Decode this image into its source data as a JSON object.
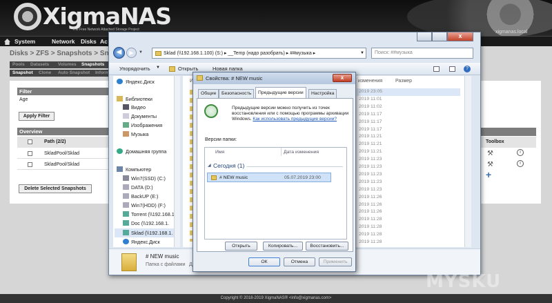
{
  "app": {
    "brand": "XigmaNAS",
    "tagline": "The Free Network Attached Storage Project",
    "hostname": "xigmanas.local"
  },
  "menu": [
    "System",
    "Network",
    "Disks",
    "Ac"
  ],
  "breadcrumb": "Disks > ZFS > Snapshots > Snap",
  "tabs1": [
    "Pools",
    "Datasets",
    "Volumes",
    "Snapshots"
  ],
  "tabs2": [
    "Snapshot",
    "Clone",
    "Auto Snapshot",
    "Inform"
  ],
  "filter": {
    "header": "Filter",
    "label": "Age",
    "button": "Apply Filter"
  },
  "overview": {
    "header": "Overview",
    "path_header": "Path (2/2)",
    "toolbox_header": "Toolbox",
    "rows": [
      "SkladPool/Sklad",
      "SkladPool/Sklad"
    ],
    "delete_button": "Delete Selected Snapshots"
  },
  "explorer": {
    "address": "Sklad (\\\\192.168.1.100) (S:)  ▸  __Temp (надо разобрать)  ▸  ##музыка  ▸",
    "search_placeholder": "Поиск: ##музыка",
    "toolbar": {
      "organize": "Упорядочить",
      "open": "Открыть",
      "new_folder": "Новая папка"
    },
    "columns": {
      "name": "И",
      "modified": "изменения",
      "size": "Размер"
    },
    "nav_items": [
      "Яндекс.Диск",
      "Библиотеки",
      "Видео",
      "Документы",
      "Изображения",
      "Музыка",
      "Домашняя группа",
      "Компьютер",
      "Win7(SSD) (C:)",
      "DATA (D:)",
      "BackUP (E:)",
      "Win7(HDD) (F:)",
      "Torrent (\\\\192.168.1",
      "Doc (\\\\192.168.1.",
      "Sklad (\\\\192.168.1.",
      "Яндекс.Диск"
    ],
    "dates": [
      "2019 23:05",
      "2019 11:01",
      "2019 11:02",
      "2019 11:17",
      "2019 11:17",
      "2019 11:17",
      "2019 11:21",
      "2019 11:21",
      "2019 11:21",
      "2019 11:23",
      "2019 11:23",
      "2019 11:23",
      "2019 11:23",
      "2019 11:23",
      "2019 11:26",
      "2019 11:26",
      "2019 11:26",
      "2019 11:28",
      "2019 11:28",
      "2019 11:28",
      "2019 11:28"
    ],
    "details": {
      "name": "# NEW music",
      "type": "Папка с файлами",
      "type_prefix": "Д"
    }
  },
  "dialog": {
    "title": "Свойства: # NEW music",
    "close": "x",
    "tabs": [
      "Общие",
      "Безопасность",
      "Предыдущие версии",
      "Настройка"
    ],
    "info_plain": "Предыдущие версии можно получить из точек восстановления или с помощью программы архивации Windows. ",
    "info_link": "Как использовать предыдущие версии?",
    "versions_label": "Версии папки:",
    "col_name": "Имя",
    "col_date": "Дата изменения",
    "group": "Сегодня (1)",
    "version_name": "# NEW music",
    "version_date": "05.07.2019 23:00",
    "buttons": {
      "open": "Открыть",
      "copy": "Копировать...",
      "restore": "Восстановить...",
      "ok": "ОК",
      "cancel": "Отмена",
      "apply": "Применить"
    }
  },
  "watermark": "MYSKU",
  "footer": "Copyright © 2018-2019 XigmaNAS® <info@xigmanas.com>"
}
